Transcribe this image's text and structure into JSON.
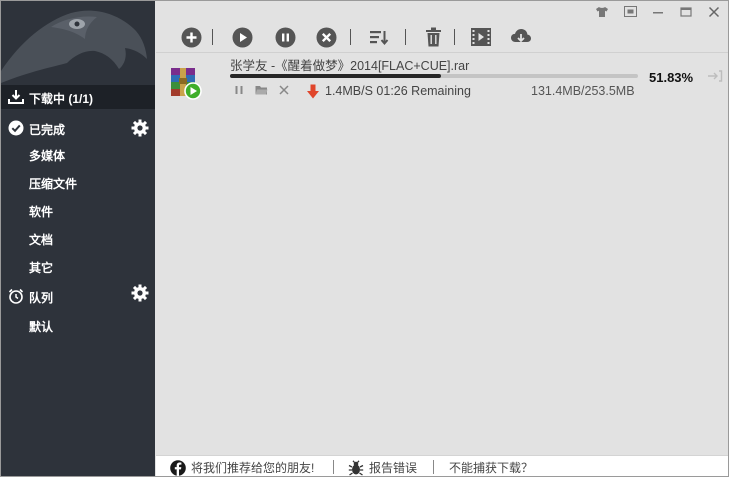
{
  "sidebar": {
    "downloading_label": "下载中 (1/1)",
    "completed_label": "已完成",
    "categories": [
      "多媒体",
      "压缩文件",
      "软件",
      "文档",
      "其它"
    ],
    "queue_label": "队列",
    "queue_items": [
      "默认"
    ]
  },
  "download": {
    "filename": "张学友 -《醒着做梦》2014[FLAC+CUE].rar",
    "progress_percent": 51.83,
    "progress_text": "51.83%",
    "speed_text": "1.4MB/S 01:26 Remaining",
    "size_text": "131.4MB/253.5MB"
  },
  "statusbar": {
    "recommend": "将我们推荐给您的朋友!",
    "report": "报告错误",
    "cannot_capture": "不能捕获下载？"
  },
  "colors": {
    "sidebar_bg": "#2e333b",
    "sidebar_active": "#1d2127",
    "content_bg": "#e2e2e2",
    "play_badge": "#3fae2a",
    "download_arrow": "#e0452b"
  }
}
